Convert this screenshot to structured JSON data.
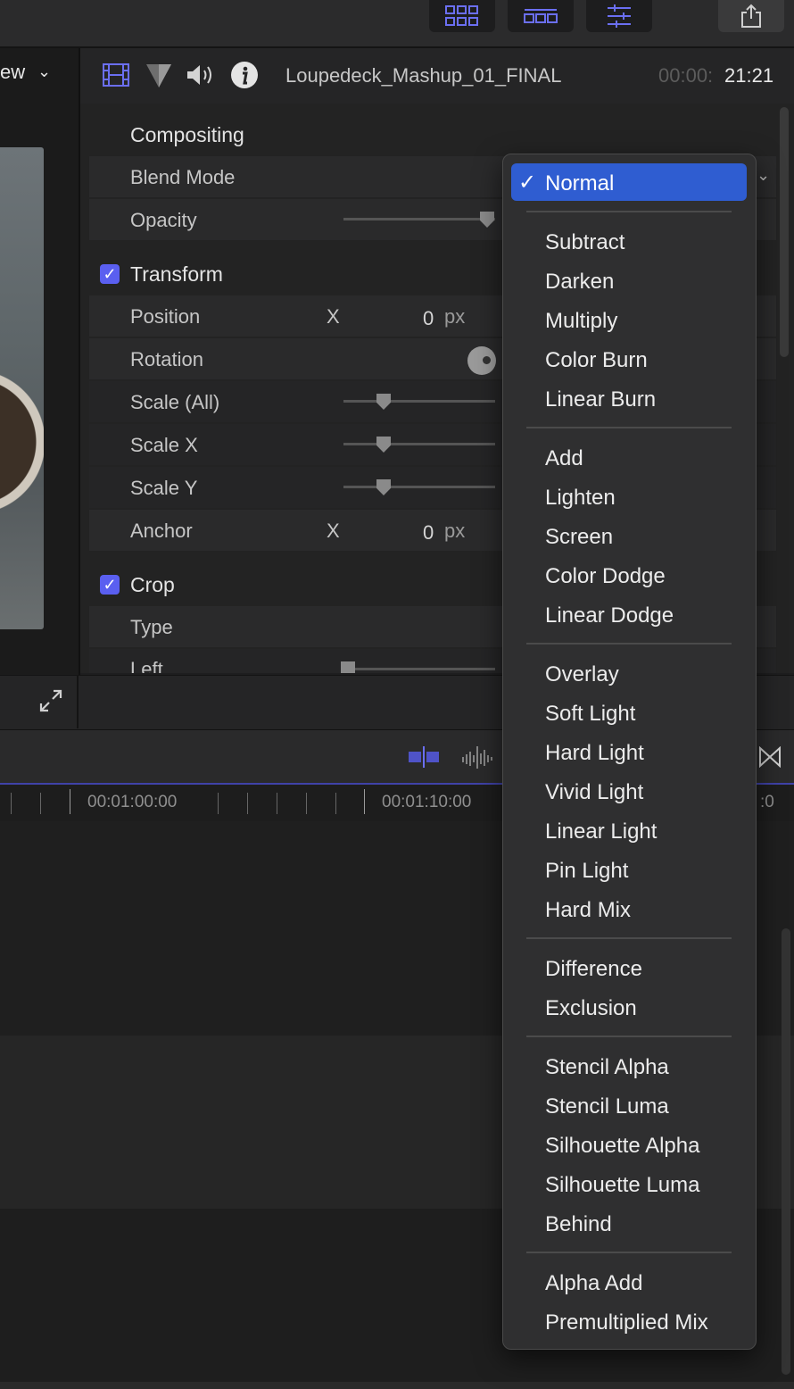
{
  "viewer": {
    "label": "ew"
  },
  "inspector": {
    "clip_name": "Loupedeck_Mashup_01_FINAL",
    "timecode_dim": "00:00:",
    "timecode": "21:21",
    "compositing": {
      "title": "Compositing",
      "blend_label": "Blend Mode",
      "opacity_label": "Opacity"
    },
    "transform": {
      "title": "Transform",
      "position_label": "Position",
      "position_x_label": "X",
      "position_x_value": "0",
      "position_x_unit": "px",
      "rotation_label": "Rotation",
      "scale_all_label": "Scale (All)",
      "scale_x_label": "Scale X",
      "scale_y_label": "Scale Y",
      "anchor_label": "Anchor",
      "anchor_x_label": "X",
      "anchor_x_value": "0",
      "anchor_x_unit": "px"
    },
    "crop": {
      "title": "Crop",
      "type_label": "Type",
      "left_label": "Left"
    }
  },
  "timeline": {
    "tc1": "00:01:00:00",
    "tc2": "00:01:10:00",
    "tc3": ":0"
  },
  "blend_menu": {
    "selected": "Normal",
    "groups": [
      [
        "Normal"
      ],
      [
        "Subtract",
        "Darken",
        "Multiply",
        "Color Burn",
        "Linear Burn"
      ],
      [
        "Add",
        "Lighten",
        "Screen",
        "Color Dodge",
        "Linear Dodge"
      ],
      [
        "Overlay",
        "Soft Light",
        "Hard Light",
        "Vivid Light",
        "Linear Light",
        "Pin Light",
        "Hard Mix"
      ],
      [
        "Difference",
        "Exclusion"
      ],
      [
        "Stencil Alpha",
        "Stencil Luma",
        "Silhouette Alpha",
        "Silhouette Luma",
        "Behind"
      ],
      [
        "Alpha Add",
        "Premultiplied Mix"
      ]
    ]
  },
  "colors": {
    "accent": "#5a5ff0",
    "menu_highlight": "#2f5dd1"
  }
}
